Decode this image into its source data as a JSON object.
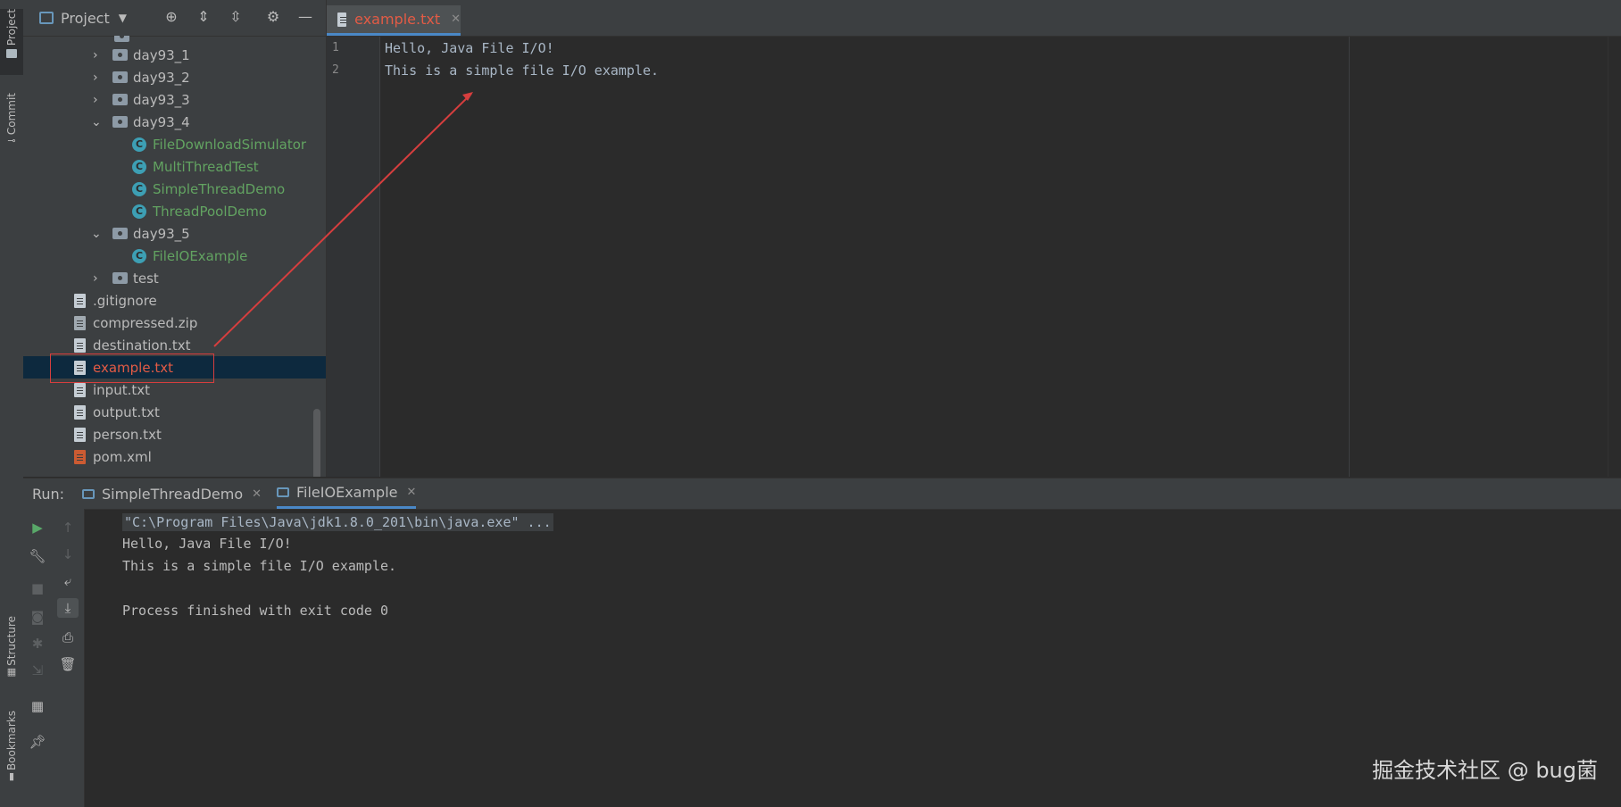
{
  "sidebar_left": {
    "project_tab": "Project",
    "commit_tab": "Commit",
    "structure_tab": "Structure",
    "bookmarks_tab": "Bookmarks"
  },
  "project": {
    "title": "Project",
    "tree": [
      {
        "label": "day93_1",
        "type": "folder",
        "expanded": false
      },
      {
        "label": "day93_2",
        "type": "folder",
        "expanded": false
      },
      {
        "label": "day93_3",
        "type": "folder",
        "expanded": false
      },
      {
        "label": "day93_4",
        "type": "folder",
        "expanded": true
      },
      {
        "label": "FileDownloadSimulator",
        "type": "class"
      },
      {
        "label": "MultiThreadTest",
        "type": "class"
      },
      {
        "label": "SimpleThreadDemo",
        "type": "class"
      },
      {
        "label": "ThreadPoolDemo",
        "type": "class"
      },
      {
        "label": "day93_5",
        "type": "folder",
        "expanded": true
      },
      {
        "label": "FileIOExample",
        "type": "class"
      },
      {
        "label": "test",
        "type": "folder",
        "expanded": false
      },
      {
        "label": ".gitignore",
        "type": "file"
      },
      {
        "label": "compressed.zip",
        "type": "zip"
      },
      {
        "label": "destination.txt",
        "type": "file"
      },
      {
        "label": "example.txt",
        "type": "file",
        "selected": true
      },
      {
        "label": "input.txt",
        "type": "file"
      },
      {
        "label": "output.txt",
        "type": "file"
      },
      {
        "label": "person.txt",
        "type": "file"
      },
      {
        "label": "pom.xml",
        "type": "xml"
      }
    ]
  },
  "editor": {
    "tab_label": "example.txt",
    "lines": [
      {
        "num": "1",
        "text": "Hello, Java File I/O!"
      },
      {
        "num": "2",
        "text": "This is a simple file I/O example."
      }
    ]
  },
  "run": {
    "label": "Run:",
    "tabs": [
      "SimpleThreadDemo",
      "FileIOExample"
    ],
    "active_tab": "FileIOExample",
    "console": [
      "\"C:\\Program Files\\Java\\jdk1.8.0_201\\bin\\java.exe\" ...",
      "Hello, Java File I/O!",
      "This is a simple file I/O example.",
      "",
      "Process finished with exit code 0"
    ]
  },
  "watermark": "掘金技术社区 @ bug菌",
  "colors": {
    "selected_file_text": "#e35b45",
    "class_text": "#62a361",
    "annotation": "#d63e3e",
    "selection_bg": "#0d293e"
  }
}
